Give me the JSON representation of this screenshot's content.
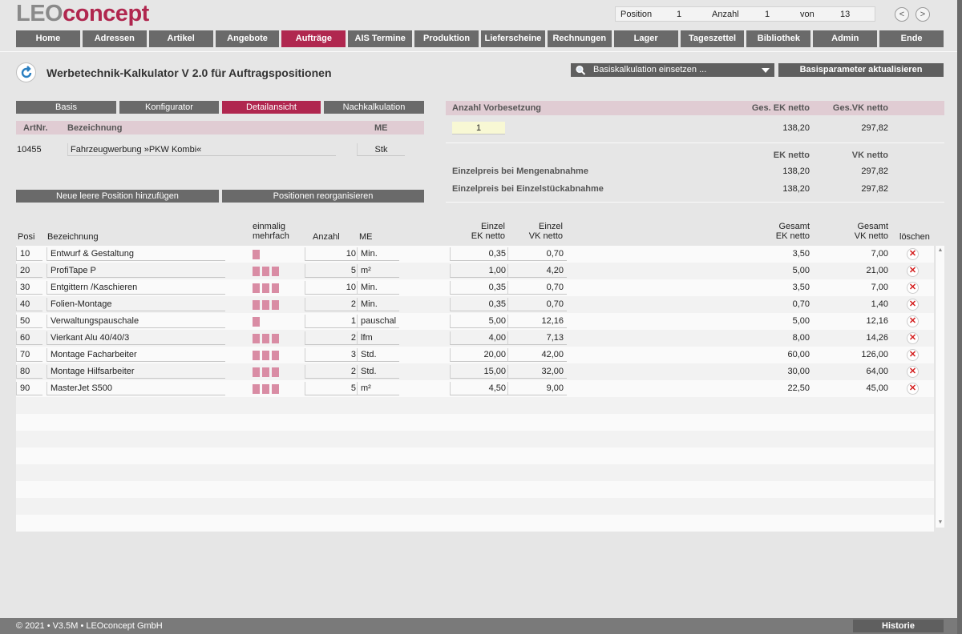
{
  "brand": {
    "leo": "LEO",
    "concept": "concept",
    "color": "#b0274f"
  },
  "counter": {
    "position_label": "Position",
    "position_value": "1",
    "count_label": "Anzahl",
    "count_value": "1",
    "of_label": "von",
    "total": "13"
  },
  "nav": {
    "prev": "<",
    "next": ">"
  },
  "menu": [
    {
      "label": "Home",
      "active": false
    },
    {
      "label": "Adressen",
      "active": false
    },
    {
      "label": "Artikel",
      "active": false
    },
    {
      "label": "Angebote",
      "active": false
    },
    {
      "label": "Aufträge",
      "active": true
    },
    {
      "label": "AIS Termine",
      "active": false
    },
    {
      "label": "Produktion",
      "active": false
    },
    {
      "label": "Lieferscheine",
      "active": false
    },
    {
      "label": "Rechnungen",
      "active": false
    },
    {
      "label": "Lager",
      "active": false
    },
    {
      "label": "Tageszettel",
      "active": false
    },
    {
      "label": "Bibliothek",
      "active": false
    },
    {
      "label": "Admin",
      "active": false
    },
    {
      "label": "Ende",
      "active": false
    }
  ],
  "page": {
    "title": "Werbetechnik-Kalkulator V 2.0 für Auftragspositionen"
  },
  "toolbar": {
    "dropdown_label": "Basiskalkulation einsetzen ...",
    "update_button": "Basisparameter aktualisieren"
  },
  "tabs": [
    {
      "label": "Basis",
      "active": false
    },
    {
      "label": "Konfigurator",
      "active": false
    },
    {
      "label": "Detailansicht",
      "active": true
    },
    {
      "label": "Nachkalkulation",
      "active": false
    }
  ],
  "article": {
    "headers": {
      "artnr": "ArtNr.",
      "name": "Bezeichnung",
      "unit": "ME"
    },
    "artnr": "10455",
    "name": "Fahrzeugwerbung »PKW Kombi«",
    "unit": "Stk"
  },
  "actions": {
    "add_position": "Neue leere Position hinzufügen",
    "reorganize": "Positionen reorganisieren"
  },
  "summary": {
    "headers": {
      "qty": "Anzahl Vorbesetzung",
      "ek": "Ges. EK netto",
      "vk": "Ges.VK netto"
    },
    "qty_value": "1",
    "ek_total": "138,20",
    "vk_total": "297,82",
    "unit_headers": {
      "ek": "EK netto",
      "vk": "VK netto"
    },
    "bulk_label": "Einzelpreis bei Mengenabnahme",
    "bulk_ek": "138,20",
    "bulk_vk": "297,82",
    "single_label": "Einzelpreis bei Einzelstückabnahme",
    "single_ek": "138,20",
    "single_vk": "297,82"
  },
  "table": {
    "headers": {
      "pos": "Posi",
      "name": "Bezeichnung",
      "once": "einmalig",
      "multi": "mehrfach",
      "qty": "Anzahl",
      "unit": "ME",
      "ek1": "Einzel",
      "ek2": "EK netto",
      "vk1": "Einzel",
      "vk2": "VK netto",
      "gek1": "Gesamt",
      "gek2": "EK netto",
      "gvk1": "Gesamt",
      "gvk2": "VK netto",
      "del": "löschen"
    },
    "rows": [
      {
        "pos": "10",
        "name": "Entwurf & Gestaltung",
        "bars": 1,
        "qty": "10",
        "unit": "Min.",
        "ek": "0,35",
        "vk": "0,70",
        "gek": "3,50",
        "gvk": "7,00"
      },
      {
        "pos": "20",
        "name": "ProfiTape P",
        "bars": 3,
        "qty": "5",
        "unit": "m²",
        "ek": "1,00",
        "vk": "4,20",
        "gek": "5,00",
        "gvk": "21,00"
      },
      {
        "pos": "30",
        "name": "Entgittern /Kaschieren",
        "bars": 3,
        "qty": "10",
        "unit": "Min.",
        "ek": "0,35",
        "vk": "0,70",
        "gek": "3,50",
        "gvk": "7,00"
      },
      {
        "pos": "40",
        "name": "Folien-Montage",
        "bars": 3,
        "qty": "2",
        "unit": "Min.",
        "ek": "0,35",
        "vk": "0,70",
        "gek": "0,70",
        "gvk": "1,40"
      },
      {
        "pos": "50",
        "name": "Verwaltungspauschale",
        "bars": 1,
        "qty": "1",
        "unit": "pauschal",
        "ek": "5,00",
        "vk": "12,16",
        "gek": "5,00",
        "gvk": "12,16"
      },
      {
        "pos": "60",
        "name": "Vierkant Alu 40/40/3",
        "bars": 3,
        "qty": "2",
        "unit": "lfm",
        "ek": "4,00",
        "vk": "7,13",
        "gek": "8,00",
        "gvk": "14,26"
      },
      {
        "pos": "70",
        "name": "Montage Facharbeiter",
        "bars": 3,
        "qty": "3",
        "unit": "Std.",
        "ek": "20,00",
        "vk": "42,00",
        "gek": "60,00",
        "gvk": "126,00"
      },
      {
        "pos": "80",
        "name": "Montage Hilfsarbeiter",
        "bars": 3,
        "qty": "2",
        "unit": "Std.",
        "ek": "15,00",
        "vk": "32,00",
        "gek": "30,00",
        "gvk": "64,00"
      },
      {
        "pos": "90",
        "name": "MasterJet S500",
        "bars": 3,
        "qty": "5",
        "unit": "m²",
        "ek": "4,50",
        "vk": "9,00",
        "gek": "22,50",
        "gvk": "45,00"
      }
    ],
    "empty_rows": 8,
    "delete_glyph": "✕",
    "scroll_up": "▲",
    "scroll_down": "▼"
  },
  "footer": {
    "copyright": "© 2021 • V3.5M • LEOconcept GmbH",
    "history_button": "Historie"
  }
}
